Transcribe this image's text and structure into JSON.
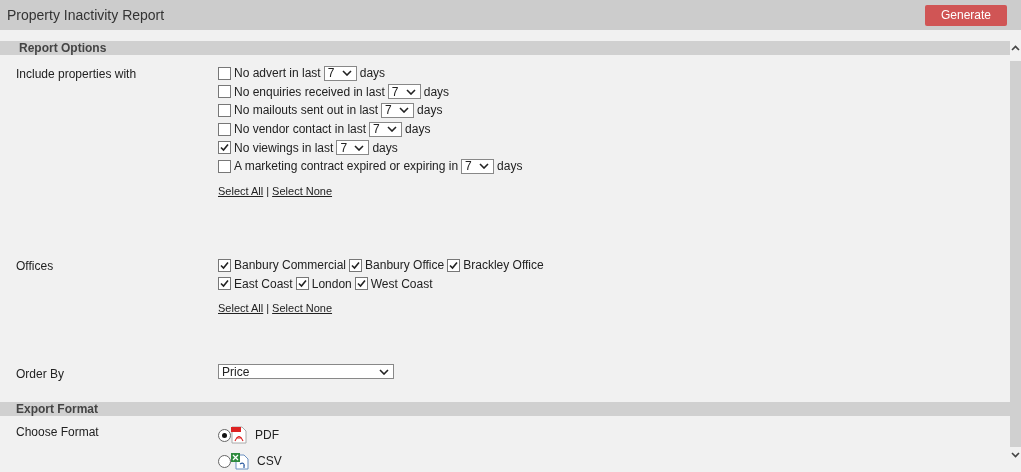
{
  "header": {
    "title": "Property Inactivity Report",
    "generate_button": "Generate"
  },
  "report_options": {
    "heading": "Report Options",
    "include": {
      "label": "Include properties with",
      "options": [
        {
          "before": "No advert in last",
          "value": "7",
          "after": "days",
          "checked": false
        },
        {
          "before": "No enquiries received in last",
          "value": "7",
          "after": "days",
          "checked": false
        },
        {
          "before": "No mailouts sent out in last",
          "value": "7",
          "after": "days",
          "checked": false
        },
        {
          "before": "No vendor contact in last",
          "value": "7",
          "after": "days",
          "checked": false
        },
        {
          "before": "No viewings in last",
          "value": "7",
          "after": "days",
          "checked": true
        },
        {
          "before": "A marketing contract expired or expiring in",
          "value": "7",
          "after": "days",
          "checked": false
        }
      ],
      "select_all": "Select All",
      "separator": "|",
      "select_none": "Select None"
    },
    "offices": {
      "label": "Offices",
      "lines": [
        [
          {
            "label": "Banbury Commercial",
            "checked": true
          },
          {
            "label": "Banbury Office",
            "checked": true
          },
          {
            "label": "Brackley Office",
            "checked": true
          }
        ],
        [
          {
            "label": "East Coast",
            "checked": true
          },
          {
            "label": "London",
            "checked": true
          },
          {
            "label": "West Coast",
            "checked": true
          }
        ]
      ],
      "select_all": "Select All",
      "separator": "|",
      "select_none": "Select None"
    },
    "order_by": {
      "label": "Order By",
      "value": "Price"
    }
  },
  "export_format": {
    "heading": "Export Format",
    "label": "Choose Format",
    "formats": [
      {
        "kind": "pdf",
        "label": "PDF",
        "selected": true
      },
      {
        "kind": "csv",
        "label": "CSV",
        "selected": false
      }
    ]
  }
}
